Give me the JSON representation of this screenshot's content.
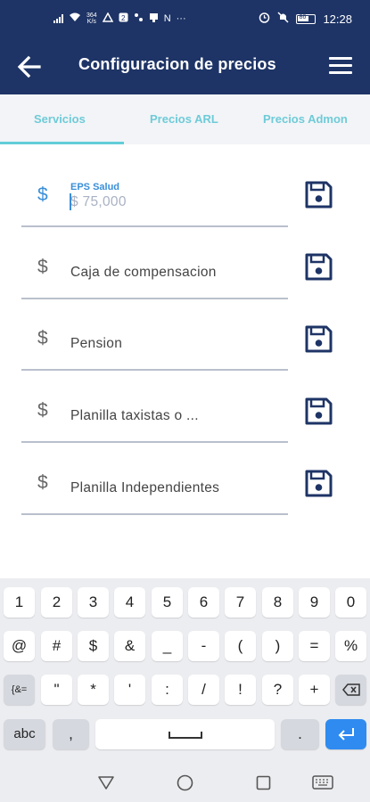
{
  "status_bar": {
    "net_speed_value": "364",
    "net_speed_unit": "K/s",
    "nfc_label": "N",
    "battery_level": "86",
    "time": "12:28"
  },
  "app_bar": {
    "title": "Configuracion de precios"
  },
  "tabs": [
    {
      "label": "Servicios",
      "selected": true
    },
    {
      "label": "Precios ARL",
      "selected": false
    },
    {
      "label": "Precios Admon",
      "selected": false
    }
  ],
  "fields": [
    {
      "label": "EPS Salud",
      "currency_symbol": "$",
      "placeholder": "$ 75,000",
      "focused": true
    },
    {
      "label": "Caja de compensacion",
      "currency_symbol": "$"
    },
    {
      "label": "Pension",
      "currency_symbol": "$"
    },
    {
      "label": "Planilla taxistas o ...",
      "currency_symbol": "$"
    },
    {
      "label": "Planilla Independientes",
      "currency_symbol": "$"
    }
  ],
  "keyboard": {
    "row1": [
      "1",
      "2",
      "3",
      "4",
      "5",
      "6",
      "7",
      "8",
      "9",
      "0"
    ],
    "row2": [
      "@",
      "#",
      "$",
      "&",
      "_",
      "-",
      "(",
      ")",
      "=",
      "%"
    ],
    "row3_mode": "{&=",
    "row3": [
      "\"",
      "*",
      "'",
      ":",
      "/",
      "!",
      "?",
      "+"
    ],
    "row4_abc": "abc",
    "row4_comma": ",",
    "row4_period": "."
  },
  "colors": {
    "app_bar": "#1e3466",
    "tab_text": "#6ecbd8",
    "tab_indicator": "#62cdd8",
    "accent_blue": "#3a8fd8",
    "save_icon": "#1e3466",
    "enter_key": "#2f8bf0"
  },
  "icons": {
    "back": "arrow-left-icon",
    "menu": "hamburger-icon",
    "save": "floppy-disk-icon"
  }
}
